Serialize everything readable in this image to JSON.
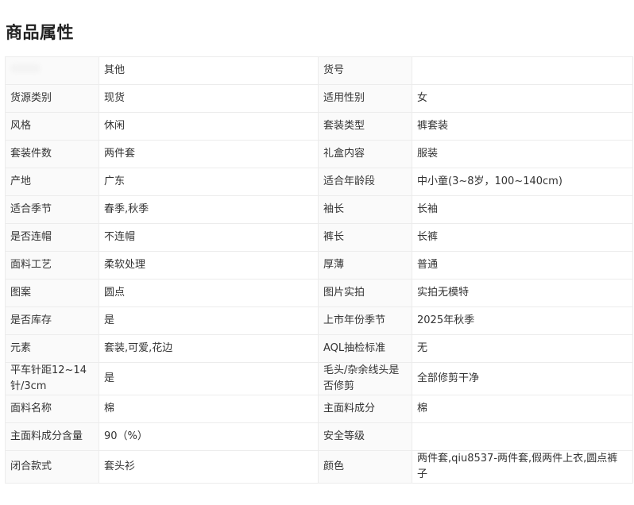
{
  "title": "商品属性",
  "rows": [
    [
      {
        "k": "",
        "v": "其他"
      },
      {
        "k": "货号",
        "v": ""
      }
    ],
    [
      {
        "k": "货源类别",
        "v": "现货"
      },
      {
        "k": "适用性别",
        "v": "女"
      }
    ],
    [
      {
        "k": "风格",
        "v": "休闲"
      },
      {
        "k": "套装类型",
        "v": "裤套装"
      }
    ],
    [
      {
        "k": "套装件数",
        "v": "两件套"
      },
      {
        "k": "礼盒内容",
        "v": "服装"
      }
    ],
    [
      {
        "k": "产地",
        "v": "广东"
      },
      {
        "k": "适合年龄段",
        "v": "中小童(3~8岁，100~140cm)"
      }
    ],
    [
      {
        "k": "适合季节",
        "v": "春季,秋季"
      },
      {
        "k": "袖长",
        "v": "长袖"
      }
    ],
    [
      {
        "k": "是否连帽",
        "v": "不连帽"
      },
      {
        "k": "裤长",
        "v": "长裤"
      }
    ],
    [
      {
        "k": "面料工艺",
        "v": "柔软处理"
      },
      {
        "k": "厚薄",
        "v": "普通"
      }
    ],
    [
      {
        "k": "图案",
        "v": "圆点"
      },
      {
        "k": "图片实拍",
        "v": "实拍无模特"
      }
    ],
    [
      {
        "k": "是否库存",
        "v": "是"
      },
      {
        "k": "上市年份季节",
        "v": "2025年秋季"
      }
    ],
    [
      {
        "k": "元素",
        "v": "套装,可爱,花边"
      },
      {
        "k": "AQL抽检标准",
        "v": "无"
      }
    ],
    [
      {
        "k": "平车针距12~14针/3cm",
        "v": "是"
      },
      {
        "k": "毛头/杂余线头是否修剪",
        "v": "全部修剪干净"
      }
    ],
    [
      {
        "k": "面料名称",
        "v": "棉"
      },
      {
        "k": "主面料成分",
        "v": "棉"
      }
    ],
    [
      {
        "k": "主面料成分含量",
        "v": "90（%）"
      },
      {
        "k": "安全等级",
        "v": ""
      }
    ],
    [
      {
        "k": "闭合款式",
        "v": "套头衫"
      },
      {
        "k": "颜色",
        "v": "两件套,qiu8537-两件套,假两件上衣,圆点裤子"
      }
    ]
  ]
}
